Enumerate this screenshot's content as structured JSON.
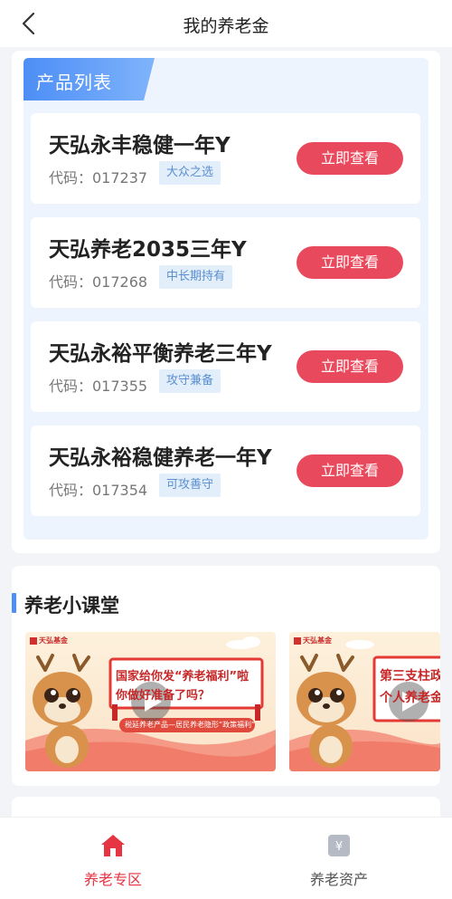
{
  "header": {
    "title": "我的养老金"
  },
  "product_list": {
    "title": "产品列表",
    "items": [
      {
        "name": "天弘永丰稳健一年Y",
        "code_label": "代码：017237",
        "tag": "大众之选",
        "button": "立即查看"
      },
      {
        "name": "天弘养老2035三年Y",
        "code_label": "代码：017268",
        "tag": "中长期持有",
        "button": "立即查看"
      },
      {
        "name": "天弘永裕平衡养老三年Y",
        "code_label": "代码：017355",
        "tag": "攻守兼备",
        "button": "立即查看"
      },
      {
        "name": "天弘永裕稳健养老一年Y",
        "code_label": "代码：017354",
        "tag": "可攻善守",
        "button": "立即查看"
      }
    ]
  },
  "classroom": {
    "title": "养老小课堂",
    "videos": [
      {
        "brand": "天弘基金",
        "headline_1": "国家给你发“养老福利”啦",
        "headline_2": "你做好准备了吗？",
        "subtitle": "税延养老产品—居民养老隐形“政策福利”"
      },
      {
        "brand": "天弘基金",
        "headline_1": "第三支柱政",
        "headline_2": "个人养老金"
      }
    ]
  },
  "tabbar": {
    "tabs": [
      {
        "label": "养老专区",
        "icon": "home-icon",
        "active": true
      },
      {
        "label": "养老资产",
        "icon": "yen-icon",
        "active": false
      }
    ]
  },
  "colors": {
    "accent_red": "#e9495c",
    "accent_blue": "#4f8ef5",
    "tag_text": "#5b8fd0"
  }
}
